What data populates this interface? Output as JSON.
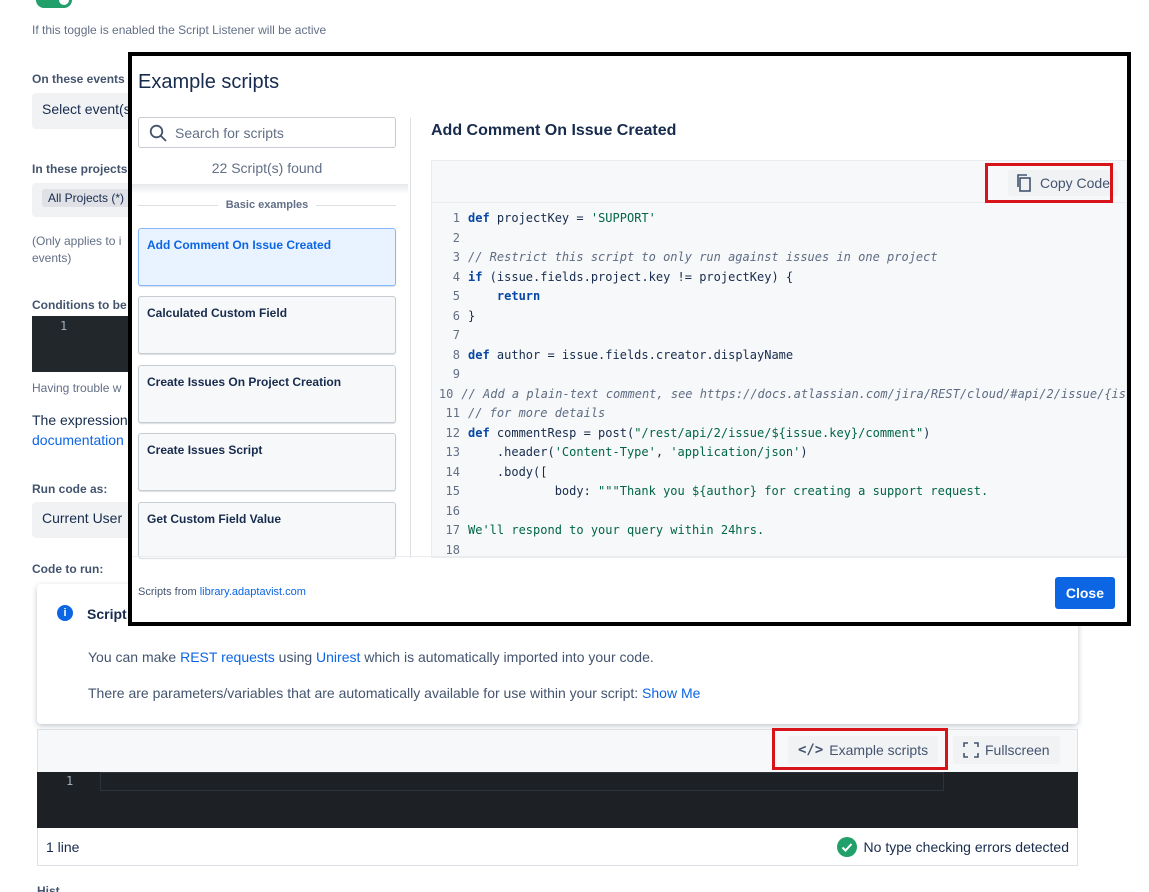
{
  "form": {
    "toggle_help": "If this toggle is enabled the Script Listener will be active",
    "events_label": "On these events",
    "events_placeholder": "Select event(s)",
    "projects_label": "In these projects",
    "projects_tag": "All Projects (*)",
    "projects_help_1": "(Only applies to i",
    "projects_help_2": "events)",
    "conditions_label": "Conditions to be",
    "conditions_line": "1",
    "trouble_text": "Having trouble w",
    "expression_text": "The expression",
    "documentation_link": "documentation",
    "run_as_label": "Run code as:",
    "run_as_value": "Current User",
    "code_label": "Code to run:",
    "bottom_label": "Hist"
  },
  "info_card": {
    "title": "Script",
    "line1_pre": "You can make ",
    "line1_link1": "REST requests",
    "line1_mid": " using ",
    "line1_link2": "Unirest",
    "line1_post": " which is automatically imported into your code.",
    "line2_pre": "There are parameters/variables that are automatically available for use within your script: ",
    "line2_link": "Show Me"
  },
  "editor": {
    "example_scripts_label": "Example scripts",
    "fullscreen_label": "Fullscreen",
    "line_number": "1",
    "line_count": "1 line",
    "type_check_status": "No type checking errors detected"
  },
  "modal": {
    "title": "Example scripts",
    "search_placeholder": "Search for scripts",
    "found_text": "22 Script(s) found",
    "section_label": "Basic examples",
    "items": [
      {
        "label": "Add Comment On Issue Created"
      },
      {
        "label": "Calculated Custom Field"
      },
      {
        "label": "Create Issues On Project Creation"
      },
      {
        "label": "Create Issues Script"
      },
      {
        "label": "Get Custom Field Value"
      }
    ],
    "selected_title": "Add Comment On Issue Created",
    "copy_label": "Copy Code",
    "footer_prefix": "Scripts from ",
    "footer_link": "library.adaptavist.com",
    "close_label": "Close",
    "code": [
      {
        "n": "1",
        "html": "<span class='kw'>def</span> projectKey = <span class='str'>'SUPPORT'</span>"
      },
      {
        "n": "2",
        "html": ""
      },
      {
        "n": "3",
        "html": "<span class='cm'>// Restrict this script to only run against issues in one project</span>"
      },
      {
        "n": "4",
        "html": "<span class='kw'>if</span> (issue.fields.project.key != projectKey) {"
      },
      {
        "n": "5",
        "html": "    <span class='kw'>return</span>"
      },
      {
        "n": "6",
        "html": "}"
      },
      {
        "n": "7",
        "html": ""
      },
      {
        "n": "8",
        "html": "<span class='kw'>def</span> author = issue.fields.creator.displayName"
      },
      {
        "n": "9",
        "html": ""
      },
      {
        "n": "10",
        "html": "<span class='cm'>// Add a plain-text comment, see https://docs.atlassian.com/jira/REST/cloud/#api/2/issue/{is</span>"
      },
      {
        "n": "11",
        "html": "<span class='cm'>// for more details</span>"
      },
      {
        "n": "12",
        "html": "<span class='kw'>def</span> commentResp = post(<span class='str'>\"/rest/api/2/issue/${issue.key}/comment\"</span>)"
      },
      {
        "n": "13",
        "html": "    .header(<span class='str'>'Content-Type'</span>, <span class='str'>'application/json'</span>)"
      },
      {
        "n": "14",
        "html": "    .body(["
      },
      {
        "n": "15",
        "html": "            body: <span class='str'>\"\"\"Thank you ${author} for creating a support request.</span>"
      },
      {
        "n": "16",
        "html": ""
      },
      {
        "n": "17",
        "html": "<span class='str'>We'll respond to your query within 24hrs.</span>"
      },
      {
        "n": "18",
        "html": ""
      }
    ]
  },
  "colors": {
    "highlight_box": "#d6141a",
    "primary": "#0c66e4",
    "success": "#22a06b"
  }
}
